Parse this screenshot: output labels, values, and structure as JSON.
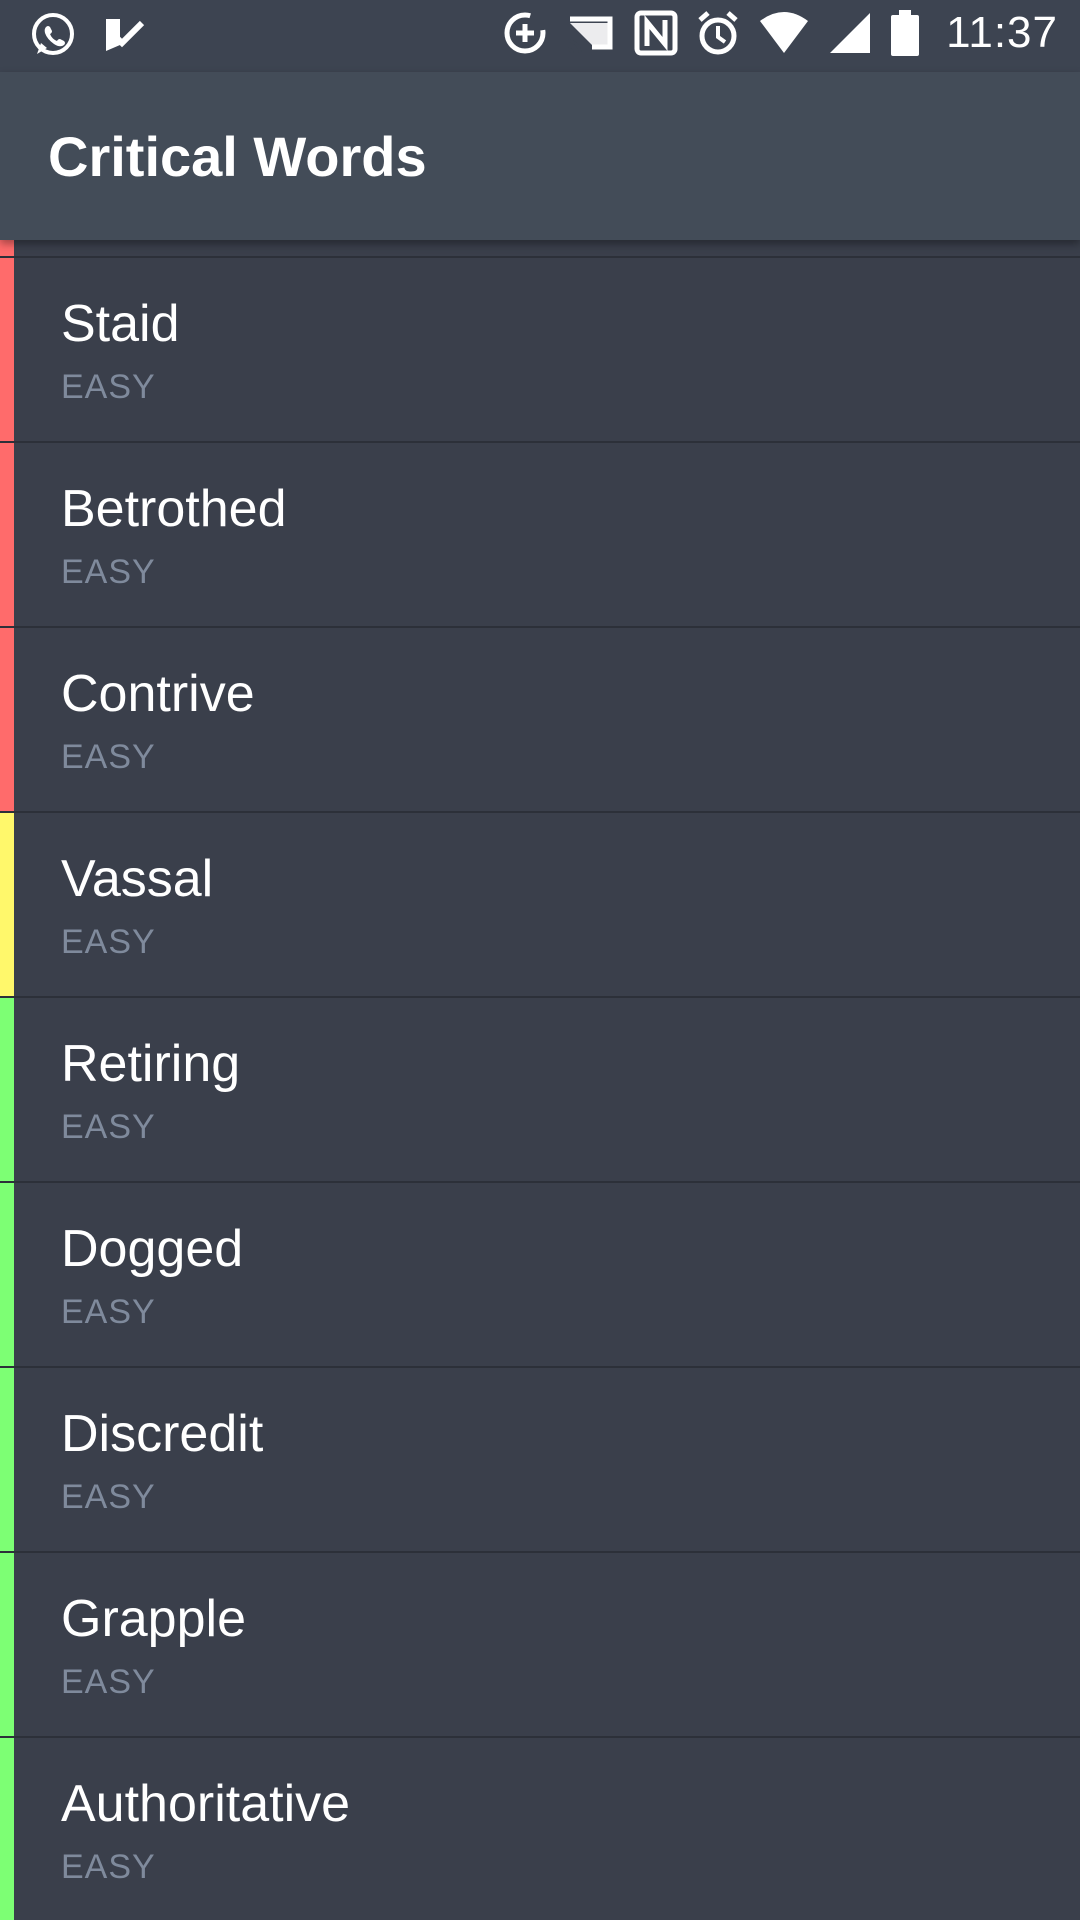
{
  "status_bar": {
    "time": "11:37",
    "left_icons": [
      "whatsapp-icon",
      "checkmark-app-icon"
    ],
    "right_icons": [
      "data-saver-icon",
      "cast-icon",
      "nfc-icon",
      "alarm-icon",
      "wifi-icon",
      "cellular-signal-icon",
      "battery-icon"
    ]
  },
  "app_bar": {
    "title": "Critical Words"
  },
  "colors": {
    "red": "#ff6b6b",
    "yellow": "#fff86b",
    "green": "#7dff74",
    "background": "#3a3f4b",
    "app_bar": "#434c58",
    "status_bar": "#3d4451",
    "subtext": "#7f8a9c"
  },
  "partial_item": {
    "color": "red"
  },
  "items": [
    {
      "word": "Staid",
      "difficulty": "EASY",
      "color": "red"
    },
    {
      "word": "Betrothed",
      "difficulty": "EASY",
      "color": "red"
    },
    {
      "word": "Contrive",
      "difficulty": "EASY",
      "color": "red"
    },
    {
      "word": "Vassal",
      "difficulty": "EASY",
      "color": "yellow"
    },
    {
      "word": "Retiring",
      "difficulty": "EASY",
      "color": "green"
    },
    {
      "word": "Dogged",
      "difficulty": "EASY",
      "color": "green"
    },
    {
      "word": "Discredit",
      "difficulty": "EASY",
      "color": "green"
    },
    {
      "word": "Grapple",
      "difficulty": "EASY",
      "color": "green"
    },
    {
      "word": "Authoritative",
      "difficulty": "EASY",
      "color": "green"
    }
  ]
}
